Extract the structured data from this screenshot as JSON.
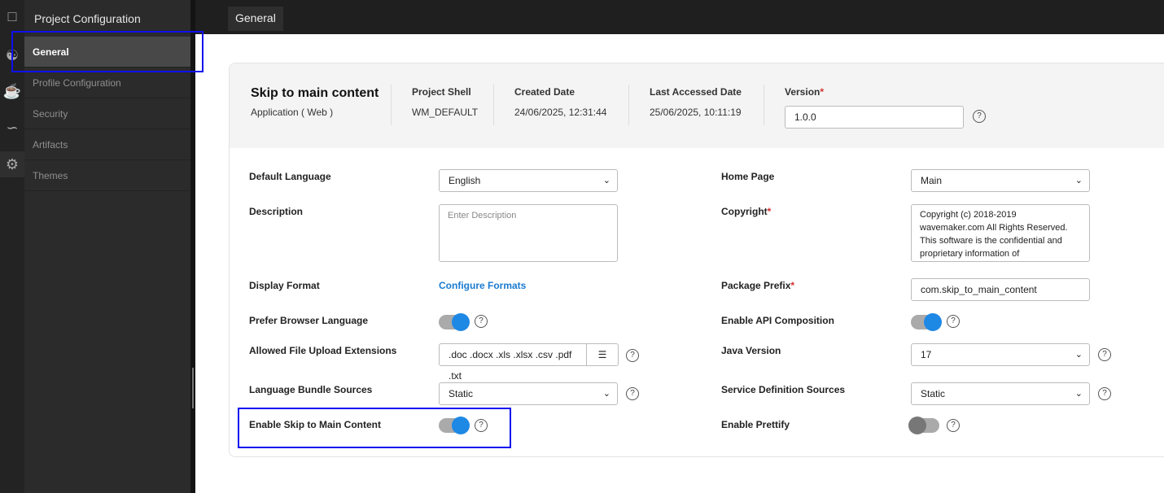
{
  "rail": {
    "icons": [
      "pages-icon",
      "database-icon",
      "java-icon",
      "workflow-icon",
      "gear-icon"
    ]
  },
  "sidebar": {
    "title": "Project Configuration",
    "items": [
      {
        "label": "General",
        "selected": true
      },
      {
        "label": "Profile Configuration"
      },
      {
        "label": "Security"
      },
      {
        "label": "Artifacts"
      },
      {
        "label": "Themes"
      }
    ]
  },
  "topbar": {
    "tab": "General"
  },
  "header": {
    "project_name": "Skip to main content",
    "project_type": "Application ( Web )",
    "shell_label": "Project Shell",
    "shell_value": "WM_DEFAULT",
    "created_label": "Created Date",
    "created_value": "24/06/2025, 12:31:44",
    "accessed_label": "Last Accessed Date",
    "accessed_value": "25/06/2025, 10:11:19",
    "version_label": "Version",
    "version_value": "1.0.0",
    "required": "*",
    "help": "?"
  },
  "form": {
    "default_language": {
      "label": "Default Language",
      "value": "English"
    },
    "description": {
      "label": "Description",
      "placeholder": "Enter Description"
    },
    "display_format": {
      "label": "Display Format",
      "link": "Configure Formats"
    },
    "prefer_browser_language": {
      "label": "Prefer Browser Language",
      "on": true
    },
    "allowed_extensions": {
      "label": "Allowed File Upload Extensions",
      "value": ".doc .docx .xls .xlsx .csv .pdf .txt"
    },
    "language_bundle": {
      "label": "Language Bundle Sources",
      "value": "Static"
    },
    "skip_main": {
      "label": "Enable Skip to Main Content",
      "on": true
    },
    "home_page": {
      "label": "Home Page",
      "value": "Main"
    },
    "copyright": {
      "label": "Copyright",
      "value": "Copyright (c) 2018-2019 wavemaker.com All Rights Reserved.  This software is the confidential and proprietary information of"
    },
    "package_prefix": {
      "label": "Package Prefix",
      "value": "com.skip_to_main_content"
    },
    "api_composition": {
      "label": "Enable API Composition",
      "on": true
    },
    "java_version": {
      "label": "Java Version",
      "value": "17"
    },
    "service_definition": {
      "label": "Service Definition Sources",
      "value": "Static"
    },
    "prettify": {
      "label": "Enable Prettify",
      "on": false
    }
  },
  "colors": {
    "accent": "#1e88e5",
    "annotation": "#1010f0",
    "required": "#d32f2f"
  }
}
